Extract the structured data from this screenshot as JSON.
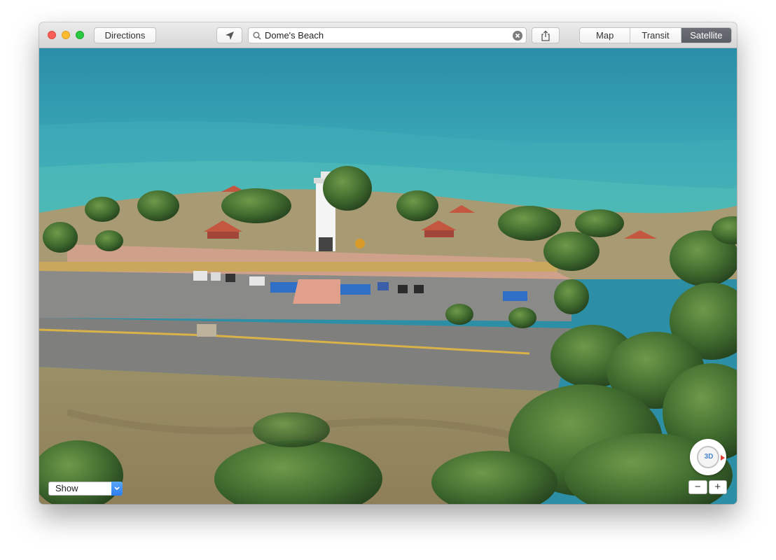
{
  "toolbar": {
    "directions_label": "Directions",
    "locate_icon": "location-arrow-icon",
    "share_icon": "share-icon",
    "search": {
      "value": "Dome's Beach",
      "icon": "search-icon",
      "clear_icon": "clear-icon"
    },
    "segments": [
      {
        "label": "Map",
        "active": false
      },
      {
        "label": "Transit",
        "active": false
      },
      {
        "label": "Satellite",
        "active": true
      }
    ]
  },
  "map": {
    "mode": "Satellite 3D flyover",
    "show_label": "Show",
    "compass_label": "3D",
    "zoom_out_label": "−",
    "zoom_in_label": "+"
  },
  "colors": {
    "ocean": "#2f97ae",
    "selected_segment": "#5f6269",
    "traffic_close": "#fc5f57",
    "traffic_minimize": "#fdbc2e",
    "traffic_zoom": "#28c840"
  }
}
